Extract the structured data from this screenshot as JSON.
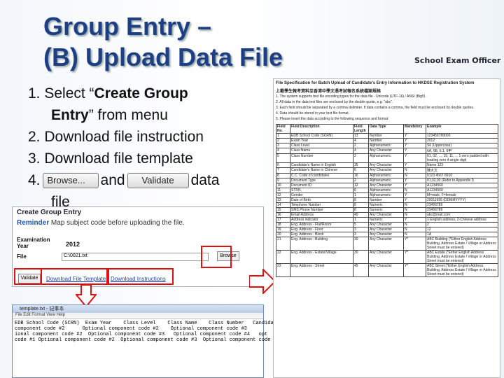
{
  "slide": {
    "title_line1": "Group Entry –",
    "title_line2": "(B) Upload Data File",
    "role": "School Exam Officer"
  },
  "steps": {
    "s1a": "1. Select “",
    "s1b": "Create Group",
    "s1c": "Entry",
    "s1d": "” from menu",
    "s2": "2. Download file instruction",
    "s3": "3. Download file template",
    "s4a": "4.",
    "s4b": "and",
    "s4c": "data",
    "s4d": "file",
    "browse_btn": "Browse...",
    "validate_btn": "Validate"
  },
  "form": {
    "heading": "Create Group Entry",
    "reminder_label": "Reminder",
    "reminder_text": "Map subject code before uploading the file.",
    "exam_year_label": "Examination Year",
    "exam_year": "2012",
    "file_label": "File",
    "file_value": "C:\\0021.txt",
    "browse": "Browse",
    "validate": "Validate",
    "link_template": "Download File Template",
    "link_instructions": "Download Instructions"
  },
  "notepad": {
    "title": "template.txt - 記事本",
    "menu": "File  Edit  Format  View  Help",
    "lines": [
      "EDB School Code (SCRN)  Exam Year    Class Level    Class Name    Class Number   Candida",
      "component code #2      Optional component code #2    Optional component code #3",
      "ional component code #2  Optional component code #3   Optional component code #4   opt",
      "code #1 Optional component code #2  Optional component code #3  Optional component code #4"
    ]
  },
  "doc": {
    "title1": "File Specification for Batch Upload of Candidate's Entry Information to HKDSE Registration System",
    "title2": "上載學生報考資料至香港中學文憑考試報名系統檔案規格",
    "instructions": [
      "1. The system supports text file encoding types for the data file - Unicode (UTF-16) / ANSI (Big5).",
      "2. All data in the data text files are enclosed by the double quote, e.g. \"abc\".",
      "3. Each field should be separated by a comma delimiter. If data contains a comma, the field must be enclosed by double quotes.",
      "4. Data should be stored in your text file format.",
      "5. Please insert the data according to the following sequence and format:"
    ],
    "headers": [
      "Field No.",
      "Field Description",
      "Field Length",
      "Data Type",
      "Mandatory",
      "Example"
    ],
    "rows": [
      [
        "1",
        "EDB School Code (SCRN)",
        "13",
        "Number",
        "Y",
        "123456789000"
      ],
      [
        "2",
        "Exam Year",
        "4",
        "Number",
        "Y",
        "2012"
      ],
      [
        "3",
        "Class Level",
        "2",
        "Alphanumeric",
        "Y",
        "S6 (Uppercase)"
      ],
      [
        "4",
        "Class Name",
        "4",
        "Any Character",
        "Y",
        "6A, 6B, 6.1, 6甲"
      ],
      [
        "5",
        "Class Number",
        "2",
        "Alphanumeric",
        "Y",
        "01, 02, ..., 10, 11, ... 1-zero padded with leading zero if single digit"
      ],
      [
        "6",
        "Candidate's Name in English",
        "35",
        "Any Character",
        "Y",
        "Name 123"
      ],
      [
        "7",
        "Candidate's Name in Chinese",
        "6",
        "Any Character",
        "N",
        "陳大文"
      ],
      [
        "8",
        "C.C. Code of candidates",
        "16",
        "Alphanumeric",
        "N",
        "0123 4567 8910"
      ],
      [
        "9",
        "Document Type",
        "2",
        "Alphanumeric",
        "Y",
        "01,02,03 (Refer to Appendix I)"
      ],
      [
        "10",
        "Document ID",
        "12",
        "Any Character",
        "Y",
        "A1234560"
      ],
      [
        "11",
        "STRN",
        "8",
        "Alphanumeric",
        "N",
        "A1234560"
      ],
      [
        "12",
        "Gender",
        "1",
        "Alphanumeric",
        "Y",
        "M=male, F=female"
      ],
      [
        "13",
        "Date of Birth",
        "8",
        "Number",
        "Y",
        "20011995 (DDMMYYYY)"
      ],
      [
        "14",
        "Telephone Number",
        "8",
        "Numeric",
        "N",
        "23456789"
      ],
      [
        "15",
        "SMS Phone Number",
        "8",
        "Numeric",
        "N",
        "23456789"
      ],
      [
        "16",
        "Email Address",
        "40",
        "Any Character",
        "N",
        "abc@mail.com"
      ],
      [
        "17",
        "Address indicator",
        "1",
        "Numeric",
        "Y",
        "1-English address, 2-Chinese address"
      ],
      [
        "18",
        "Eng. Address - Flat/Room",
        "5",
        "Any Character",
        "N",
        "2"
      ],
      [
        "19",
        "Eng. Address - Floor",
        "3",
        "Any Character",
        "N",
        "12"
      ],
      [
        "20",
        "Eng. Address - Block",
        "3",
        "Any Character",
        "N",
        "1A"
      ],
      [
        "21",
        "Eng. Address - Building",
        "30",
        "Any Character",
        "Y*",
        "ABC Building (*Either English Address Building, Address Estate / Village or Address Street must be entered)"
      ],
      [
        "22",
        "Eng. Address - Estate/Village",
        "30",
        "Any Character",
        "Y*",
        "ABC Estate (*Either English Address Building, Address Estate / Village or Address Street must be entered)"
      ],
      [
        "23",
        "Eng. Address - Street",
        "45",
        "Any Character",
        "Y*",
        "ABC Street (*Either English Address Building, Address Estate / Village or Address Street must be entered)"
      ]
    ]
  }
}
